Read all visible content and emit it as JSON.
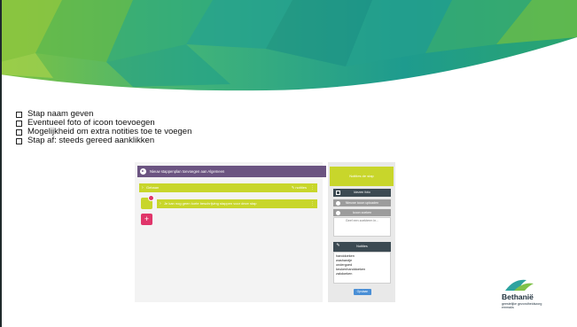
{
  "bullets": [
    {
      "text": "Stap naam geven"
    },
    {
      "text": "Eventueel foto of icoon toevoegen"
    },
    {
      "text": "Mogelijkheid om extra notities toe te voegen"
    },
    {
      "text": "Stap af: steeds gereed aanklikken"
    }
  ],
  "app": {
    "header_text": "Nieuw stappenplan toevoegen aan Algemeen",
    "step1_label": "Gebaan",
    "step1_right": "✎ notities",
    "step2_label": "Je kan nog geen korte beschrijving stappen voor deze stap",
    "add_symbol": "+",
    "panel": {
      "title": "Notities de stap",
      "choose_btn": "kiezen foto",
      "upload_btn": "Nieuwe icoon uploaden",
      "search_btn": "Icoon zoeken",
      "search_placeholder": "Geef een zoekterm in...",
      "notes_btn": "Notities",
      "notes": [
        "handdoeken",
        "washandje",
        "ondergoed",
        "keukenhanddoeken",
        "zakdoeken"
      ],
      "save_btn": "Opslaan"
    }
  },
  "logo": {
    "name": "Bethanië",
    "line1": "geestelijke gezondheidszorg",
    "line2": "emmaüs"
  },
  "colors": {
    "banner_teal": "#1fa08d",
    "banner_green": "#8cc63f",
    "header_purple": "#6b5481",
    "step_lime": "#c8d62b",
    "add_pink": "#e0356a",
    "panel_dark": "#3c4a52"
  }
}
